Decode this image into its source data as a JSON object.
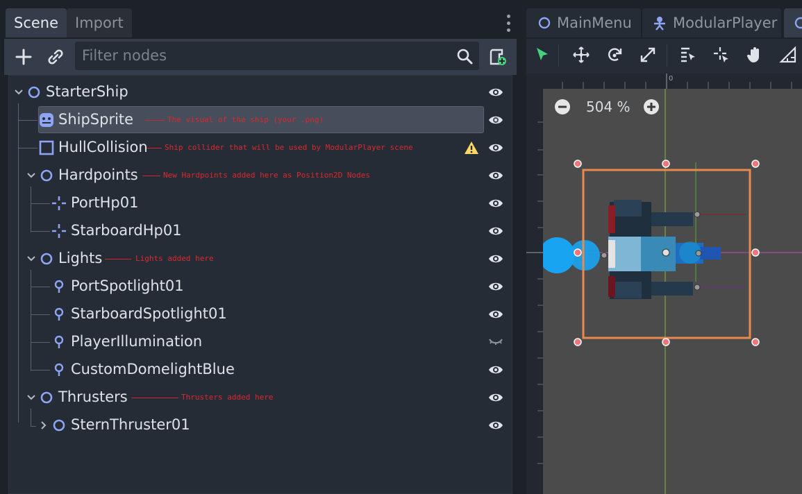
{
  "scene_dock": {
    "tabs": [
      {
        "label": "Scene",
        "active": true
      },
      {
        "label": "Import",
        "active": false
      }
    ],
    "filter_placeholder": "Filter nodes"
  },
  "tree": {
    "nodes": [
      {
        "id": "starter",
        "label": "StarterShip",
        "icon": "node2d-circle-icon",
        "selected": false
      },
      {
        "id": "sprite",
        "label": "ShipSprite",
        "icon": "sprite-icon",
        "selected": true,
        "annotation": "The visual of the ship (your .png)"
      },
      {
        "id": "hull",
        "label": "HullCollision",
        "icon": "collision-square-icon",
        "annotation": "Ship collider that will be used by ModularPlayer scene",
        "warning": true
      },
      {
        "id": "hardpoints",
        "label": "Hardpoints",
        "icon": "node2d-circle-icon",
        "annotation": "New Hardpoints added here as Position2D Nodes"
      },
      {
        "id": "porthp",
        "label": "PortHp01",
        "icon": "position2d-icon"
      },
      {
        "id": "starhp",
        "label": "StarboardHp01",
        "icon": "position2d-icon"
      },
      {
        "id": "lights",
        "label": "Lights",
        "icon": "node2d-circle-icon",
        "annotation": "Lights added here"
      },
      {
        "id": "portspot",
        "label": "PortSpotlight01",
        "icon": "light-bulb-icon"
      },
      {
        "id": "starspot",
        "label": "StarboardSpotlight01",
        "icon": "light-bulb-icon"
      },
      {
        "id": "illum",
        "label": "PlayerIllumination",
        "icon": "light-bulb-icon",
        "hidden": true
      },
      {
        "id": "dome",
        "label": "CustomDomelightBlue",
        "icon": "light-bulb-icon"
      },
      {
        "id": "thrusters",
        "label": "Thrusters",
        "icon": "node2d-circle-icon",
        "annotation": "Thrusters added here"
      },
      {
        "id": "stern",
        "label": "SternThruster01",
        "icon": "node2d-circle-icon"
      }
    ]
  },
  "viewport": {
    "tabs": [
      {
        "label": "MainMenu",
        "icon": "node2d-circle-icon"
      },
      {
        "label": "ModularPlayer",
        "icon": "kinematic-body-icon"
      }
    ],
    "zoom": "504 %",
    "ruler_origin_label": "0"
  },
  "colors": {
    "accent_blue": "#8da5f3",
    "annotation_red": "#d72a2f",
    "selection_orange": "#e88a4f",
    "select_tool_green": "#45d27e"
  }
}
